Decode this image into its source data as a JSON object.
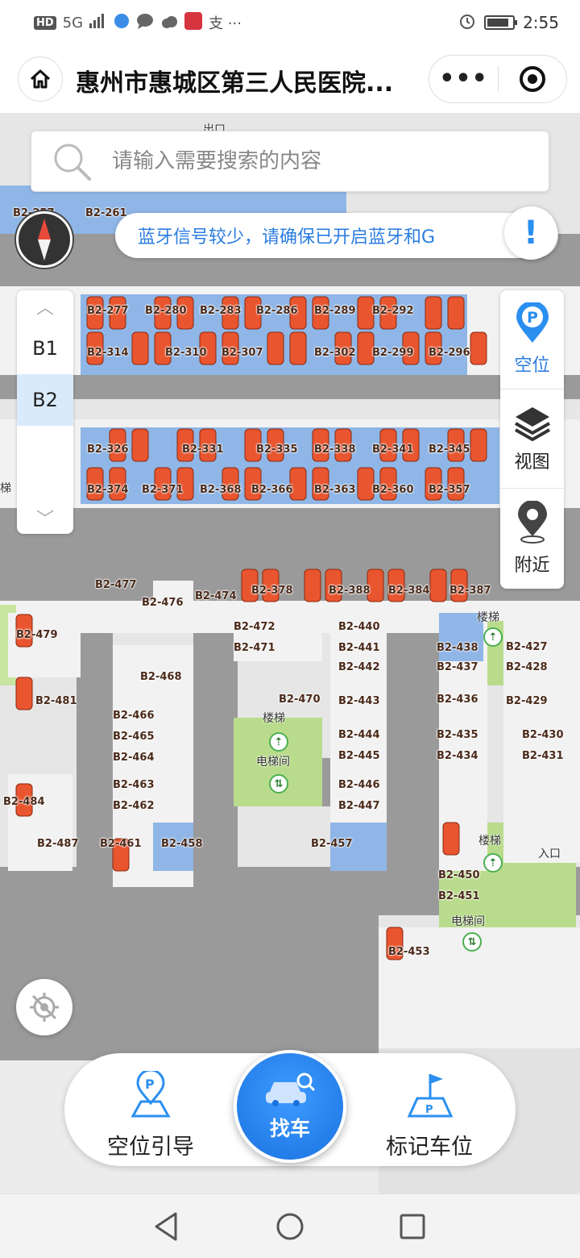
{
  "status_bar": {
    "network": "HD",
    "signal": "5G",
    "app_glyphs": "支 ···",
    "time": "2:55",
    "battery_fraction": 0.88
  },
  "header": {
    "title": "惠州市惠城区第三人民医院...",
    "more_label": "•••"
  },
  "search": {
    "placeholder": "请输入需要搜索的内容"
  },
  "notice": {
    "text": "蓝牙信号较少，请确保已开启蓝牙和G",
    "button": "!"
  },
  "floors": {
    "items": [
      "B1",
      "B2"
    ],
    "selected": "B2"
  },
  "right_panel": {
    "items": [
      {
        "label": "空位",
        "icon": "parking-pin-icon"
      },
      {
        "label": "视图",
        "icon": "layers-icon"
      },
      {
        "label": "附近",
        "icon": "location-pin-icon"
      }
    ]
  },
  "map": {
    "slots": [
      "B2-257",
      "B2-261",
      "B2-277",
      "B2-280",
      "B2-283",
      "B2-286",
      "B2-289",
      "B2-292",
      "B2-314",
      "B2-310",
      "B2-307",
      "B2-302",
      "B2-299",
      "B2-296",
      "B2-326",
      "B2-331",
      "B2-335",
      "B2-338",
      "B2-341",
      "B2-345",
      "B2-374",
      "B2-371",
      "B2-368",
      "B2-366",
      "B2-363",
      "B2-360",
      "B2-357",
      "B2-477",
      "B2-476",
      "B2-474",
      "B2-378",
      "B2-388",
      "B2-384",
      "B2-387",
      "B2-479",
      "B2-472",
      "B2-471",
      "B2-440",
      "B2-441",
      "B2-442",
      "B2-438",
      "B2-437",
      "B2-427",
      "B2-428",
      "B2-468",
      "B2-481",
      "B2-470",
      "B2-443",
      "B2-436",
      "B2-429",
      "B2-466",
      "B2-465",
      "B2-464",
      "B2-444",
      "B2-445",
      "B2-435",
      "B2-434",
      "B2-430",
      "B2-431",
      "B2-484",
      "B2-463",
      "B2-462",
      "B2-446",
      "B2-447",
      "B2-487",
      "B2-461",
      "B2-458",
      "B2-457",
      "B2-450",
      "B2-451",
      "B2-453"
    ],
    "labels": {
      "stairs": "楼梯",
      "elevator": "电梯间",
      "exit": "出口",
      "entrance": "入口",
      "stairs_short": "梯"
    }
  },
  "bottom_bar": {
    "left": "空位引导",
    "center": "找车",
    "right": "标记车位"
  },
  "colors": {
    "accent": "#2b7de0",
    "road": "#9a9a9a",
    "slot_blue": "#8fb6e6",
    "car_orange": "#e8552f",
    "green_area": "#b9dc8c"
  }
}
